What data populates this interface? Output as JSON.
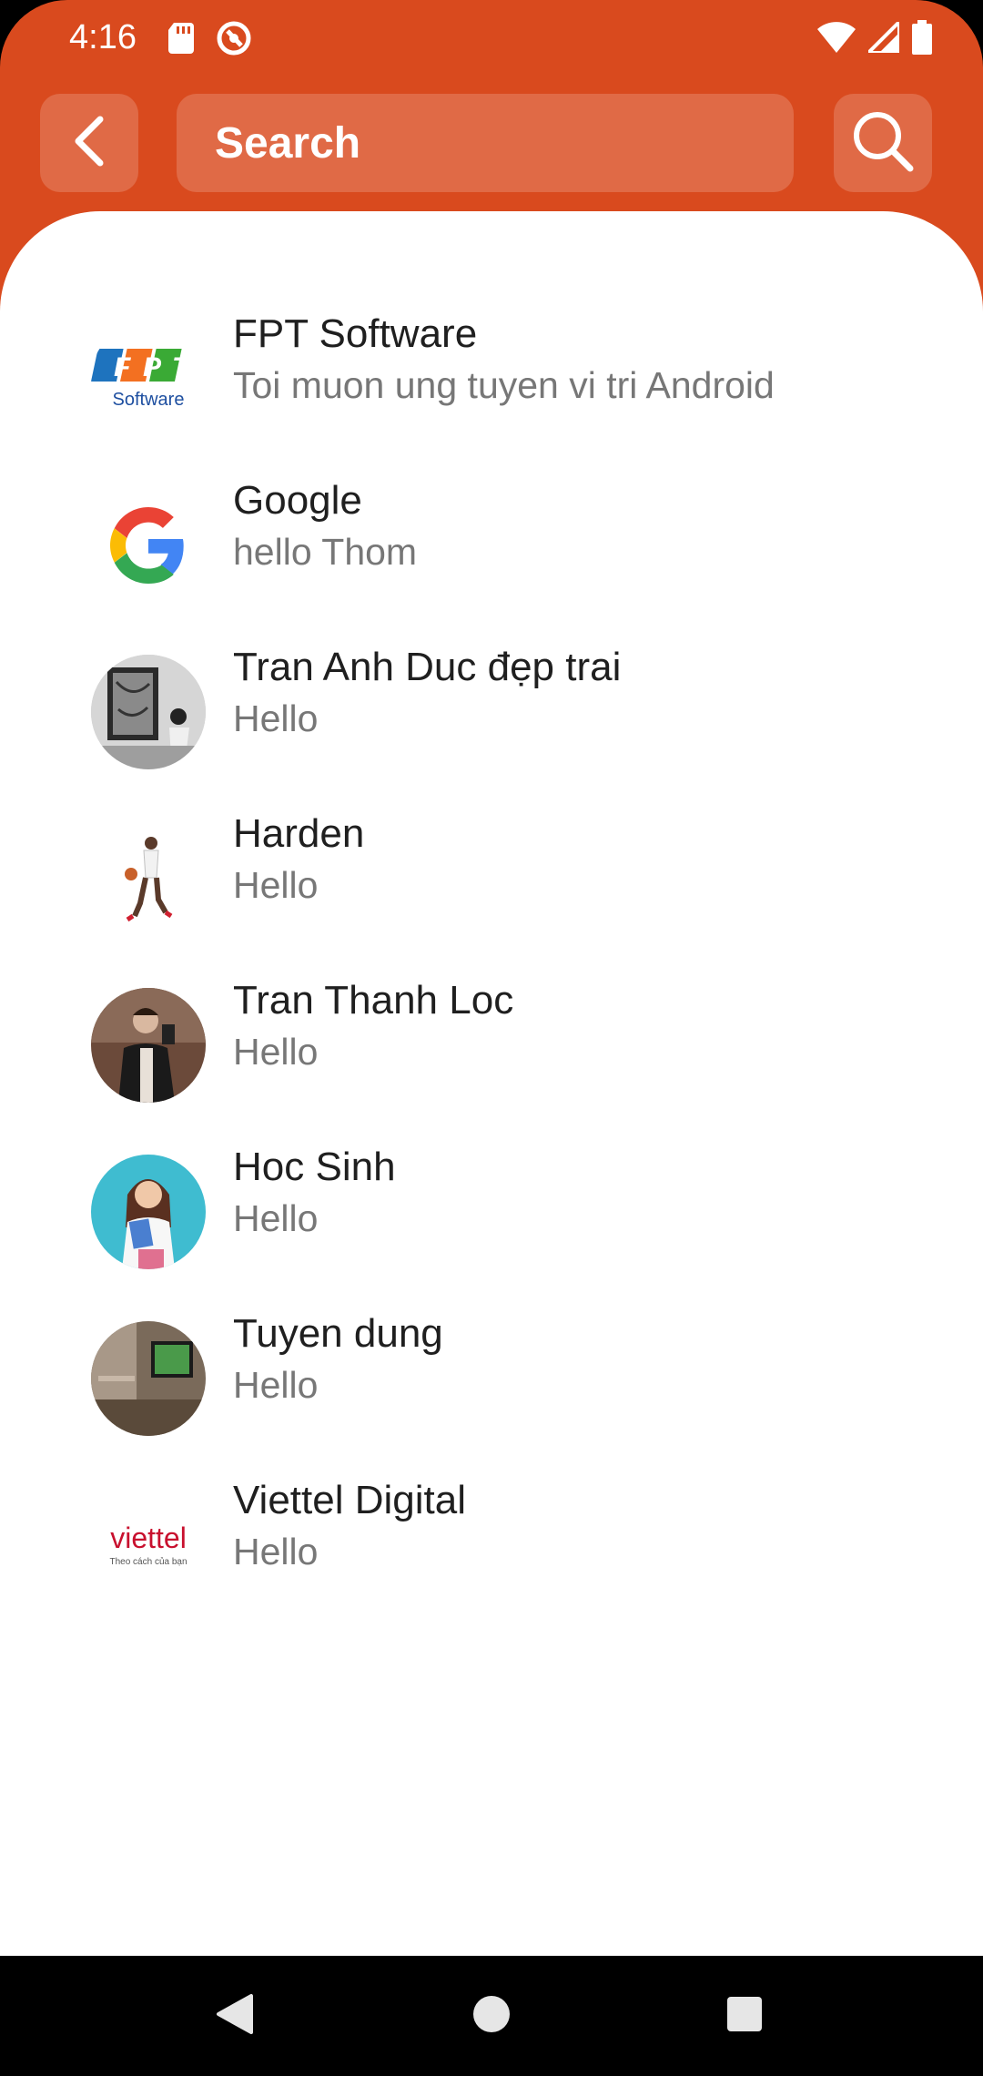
{
  "status_bar": {
    "time": "4:16",
    "left_icons": [
      "sd-card-icon",
      "vpn-icon"
    ],
    "right_icons": [
      "wifi-icon",
      "signal-icon",
      "battery-icon"
    ]
  },
  "header": {
    "search_placeholder": "Search",
    "back_icon": "chevron-left-icon",
    "search_icon": "magnifier-icon",
    "accent_color": "#D94A1E"
  },
  "conversations": [
    {
      "name": "FPT Software",
      "last_message": "Toi muon ung tuyen vi tri Android",
      "avatar": "fpt-logo"
    },
    {
      "name": "Google",
      "last_message": "hello Thom",
      "avatar": "google-logo"
    },
    {
      "name": "Tran Anh Duc đẹp trai",
      "last_message": "Hello",
      "avatar": "photo-man-with-painting"
    },
    {
      "name": "Harden",
      "last_message": "Hello",
      "avatar": "photo-basketball-player"
    },
    {
      "name": "Tran Thanh Loc",
      "last_message": "Hello",
      "avatar": "photo-man-selfie"
    },
    {
      "name": "Hoc Sinh",
      "last_message": "Hello",
      "avatar": "photo-student-girl"
    },
    {
      "name": "Tuyen dung",
      "last_message": "Hello",
      "avatar": "photo-room-interior"
    },
    {
      "name": "Viettel Digital",
      "last_message": "Hello",
      "avatar": "viettel-logo"
    }
  ],
  "logos": {
    "fpt_letters": [
      "F",
      "P",
      "T"
    ],
    "fpt_caption": "Software",
    "viettel_wordmark": "viettel",
    "viettel_tagline": "Theo cách của bạn"
  },
  "nav_bar": [
    "back-triangle-icon",
    "home-circle-icon",
    "recents-square-icon"
  ]
}
